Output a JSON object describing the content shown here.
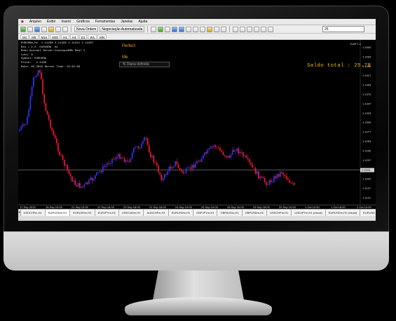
{
  "menu": [
    "Arquivo",
    "Exibir",
    "Inserir",
    "Gráficos",
    "Ferramentas",
    "Janelas",
    "Ajuda"
  ],
  "toolbar": {
    "new_order_label": "Nova Ordem",
    "auto_trading_label": "Negociação Automatizada",
    "zoom_value": "25"
  },
  "timeframes": [
    "M1",
    "M5",
    "M15",
    "M30",
    "H1",
    "H4",
    "D1",
    "W1",
    "MN"
  ],
  "chart": {
    "header": "EURUSDm,H1  1.11288 1.11329 1.11211 1.11297",
    "info_lines": [
      "Bto = 1.5  EURUSDm  H1",
      "Robo Account Server:ConsiquiBRo Real 1",
      "Lots: 0",
      "Symbol: EURUSDm",
      "Price:   1.1196",
      "Date: 02.2015 Server Time: 10:23:36"
    ],
    "ea_name": "Perfect",
    "ea_me": "Me",
    "ea_field": "% Diana definida",
    "saldo": "Saldo total : 25.78",
    "corner_label": "EUR 1.1",
    "price_labels": [
      "1.1500",
      "1.1463",
      "1.1440",
      "1.1417",
      "1.1393",
      "1.1370",
      "1.1347",
      "1.1323",
      "1.1300",
      "1.1277",
      "1.1253",
      "1.1230",
      "1.1207",
      "1.1183",
      "1.1160",
      "1.1137",
      "1.1113"
    ],
    "current_price": "1.1193",
    "bid_line_fraction": 0.79,
    "x_labels": [
      "17 Sep 2015",
      "18 Sep 10:00",
      "21 Sep 10:00",
      "22 Sep 18:00",
      "23 Sep 18:00",
      "21 Sep 18:00",
      "24 Sep 10:00",
      "25 Sep 10:00",
      "28 Sep 10:00",
      "29 Sep 18:00",
      "30 Sep 10:00",
      "1 Oct 10:00",
      "1 Oct 18:00",
      "2 Oct 10:00"
    ]
  },
  "tabs": [
    "USDCHFm,H1",
    "EURUSDm,H1",
    "EURUSDm,H1",
    "EURJPYm,H1",
    "USDCADm,H1",
    "AUDCHFm,H1",
    "EURUSDm,H1",
    "GBPJPYm,H1",
    "GBPAUDm,H1",
    "GBPUSDm,H1",
    "USDCHFm,H1",
    "USDJPYm,H1 (visual)",
    "EURUSDm,H1 (visual)",
    "EURUSD"
  ],
  "active_tab_index": 1,
  "colors": {
    "bull_candle": "#2a3cff",
    "bear_candle": "#ff1a2e",
    "saldo": "#f0b800",
    "ea_text": "#f0a020"
  }
}
